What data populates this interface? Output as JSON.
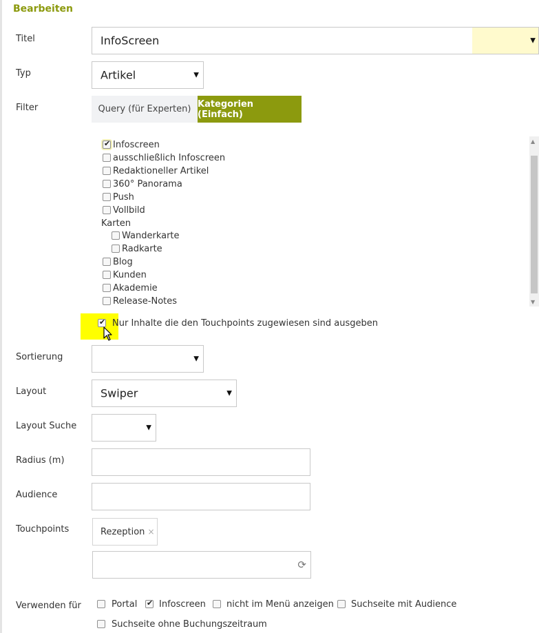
{
  "dialog": {
    "title": "Bearbeiten"
  },
  "form": {
    "titel": {
      "label": "Titel",
      "value": "InfoScreen",
      "color": "#fffacd"
    },
    "typ": {
      "label": "Typ",
      "value": "Artikel"
    },
    "filter": {
      "label": "Filter",
      "tabs": [
        {
          "label": "Query (für Experten)",
          "active": false
        },
        {
          "label": "Kategorien (Einfach)",
          "active": true
        }
      ],
      "categories": [
        {
          "label": "Infoscreen",
          "checked": true
        },
        {
          "label": "ausschließlich Infoscreen",
          "checked": false
        },
        {
          "label": "Redaktioneller Artikel",
          "checked": false
        },
        {
          "label": "360° Panorama",
          "checked": false
        },
        {
          "label": "Push",
          "checked": false
        },
        {
          "label": "Vollbild",
          "checked": false
        }
      ],
      "group_label": "Karten",
      "group_items": [
        {
          "label": "Wanderkarte",
          "checked": false
        },
        {
          "label": "Radkarte",
          "checked": false
        }
      ],
      "more_categories": [
        {
          "label": "Blog",
          "checked": false
        },
        {
          "label": "Kunden",
          "checked": false
        },
        {
          "label": "Akademie",
          "checked": false
        },
        {
          "label": "Release-Notes",
          "checked": false
        }
      ],
      "touchpoints_only": {
        "label": "Nur Inhalte die den Touchpoints zugewiesen sind ausgeben",
        "checked": true
      }
    },
    "sortierung": {
      "label": "Sortierung",
      "value": ""
    },
    "layout": {
      "label": "Layout",
      "value": "Swiper"
    },
    "layout_suche": {
      "label": "Layout Suche",
      "value": ""
    },
    "radius": {
      "label": "Radius (m)",
      "value": ""
    },
    "audience": {
      "label": "Audience",
      "value": ""
    },
    "touchpoints": {
      "label": "Touchpoints",
      "tag": "Rezeption",
      "remove_glyph": "×",
      "input_value": ""
    },
    "verwenden_fuer": {
      "label": "Verwenden für",
      "options": [
        {
          "label": "Portal",
          "checked": false
        },
        {
          "label": "Infoscreen",
          "checked": true
        },
        {
          "label": "nicht im Menü anzeigen",
          "checked": false
        },
        {
          "label": "Suchseite mit Audience",
          "checked": false
        },
        {
          "label": "Suchseite ohne Buchungszeitraum",
          "checked": false
        }
      ]
    }
  },
  "colors": {
    "accent": "#8c9a0e",
    "highlight": "#ffff00",
    "tab_inactive": "#f1f2f4"
  },
  "icons": {
    "select": "caret-down-icon",
    "refresh": "refresh-icon",
    "cursor": "mouse-pointer-icon"
  }
}
